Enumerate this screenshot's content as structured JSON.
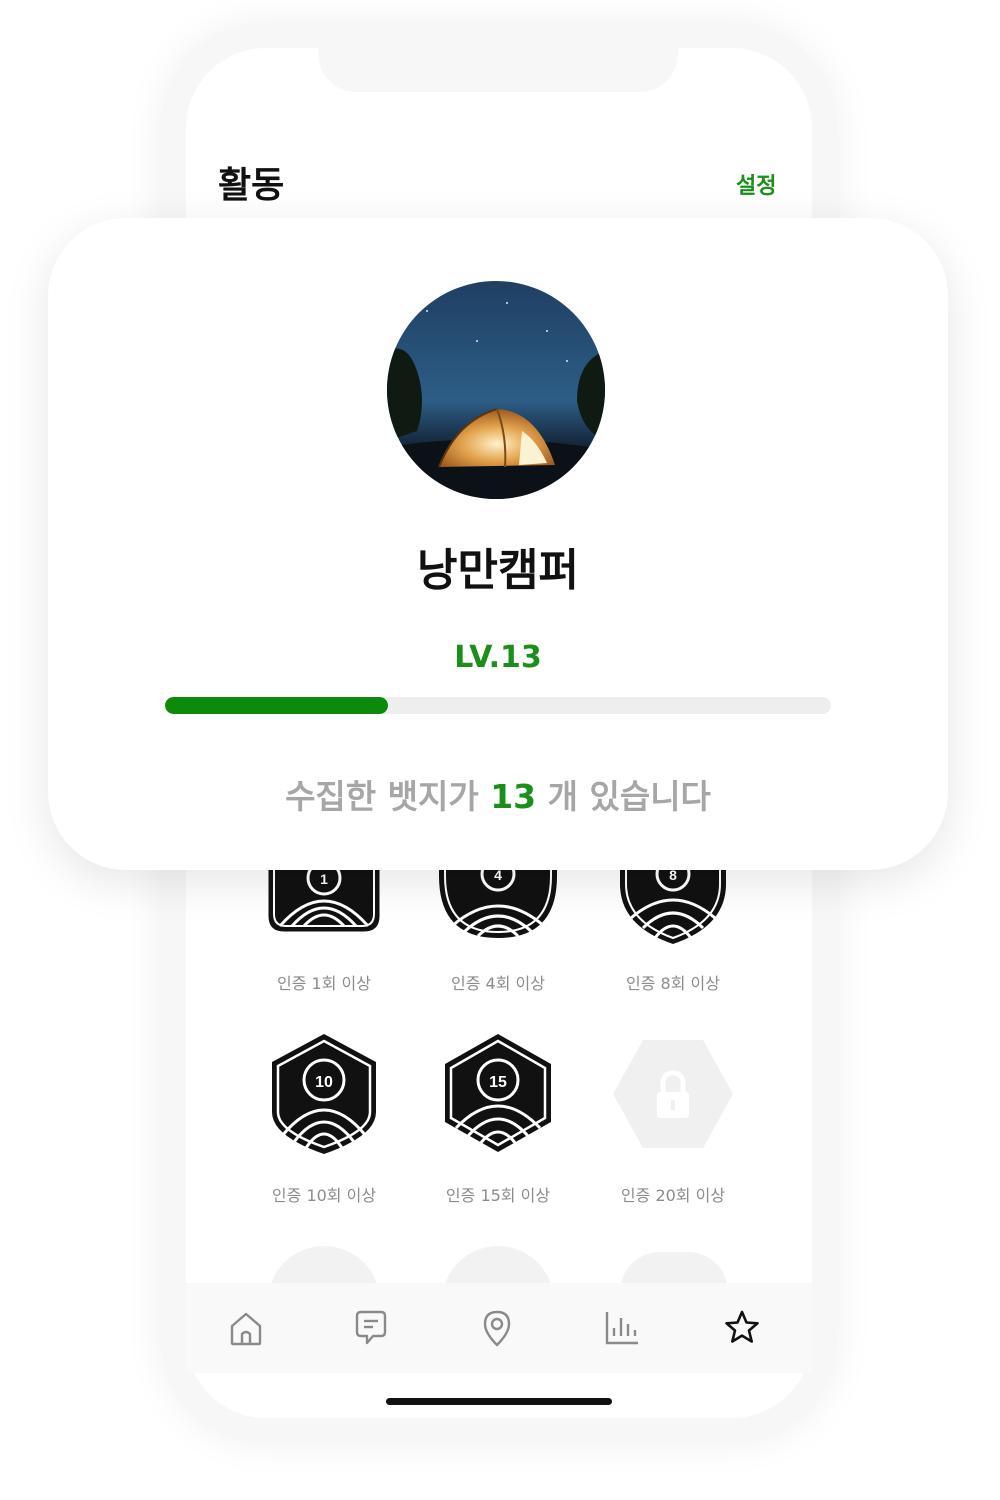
{
  "header": {
    "title": "활동",
    "settings_label": "설정"
  },
  "profile": {
    "avatar_icon": "tent-night-photo",
    "nickname": "낭만캠퍼",
    "level_label": "LV.13",
    "level_progress": 0.335,
    "badge_message": {
      "before": "수집한 뱃지가 ",
      "count": "13",
      "after": " 개 있습니다"
    }
  },
  "badges": [
    {
      "number": "1",
      "label": "인증 1회 이상",
      "locked": false
    },
    {
      "number": "4",
      "label": "인증 4회 이상",
      "locked": false
    },
    {
      "number": "8",
      "label": "인증 8회 이상",
      "locked": false
    },
    {
      "number": "10",
      "label": "인증 10회 이상",
      "locked": false
    },
    {
      "number": "15",
      "label": "인증 15회 이상",
      "locked": false
    },
    {
      "number": "",
      "label": "인증 20회 이상",
      "locked": true
    }
  ],
  "tabbar": {
    "items": [
      {
        "icon": "home-icon",
        "active": false
      },
      {
        "icon": "message-icon",
        "active": false
      },
      {
        "icon": "location-pin-icon",
        "active": false
      },
      {
        "icon": "bar-chart-icon",
        "active": false
      },
      {
        "icon": "star-icon",
        "active": true
      }
    ]
  },
  "colors": {
    "accent": "#1a8f1a",
    "progress": "#0b8a0b",
    "muted": "#a6a6a6"
  }
}
